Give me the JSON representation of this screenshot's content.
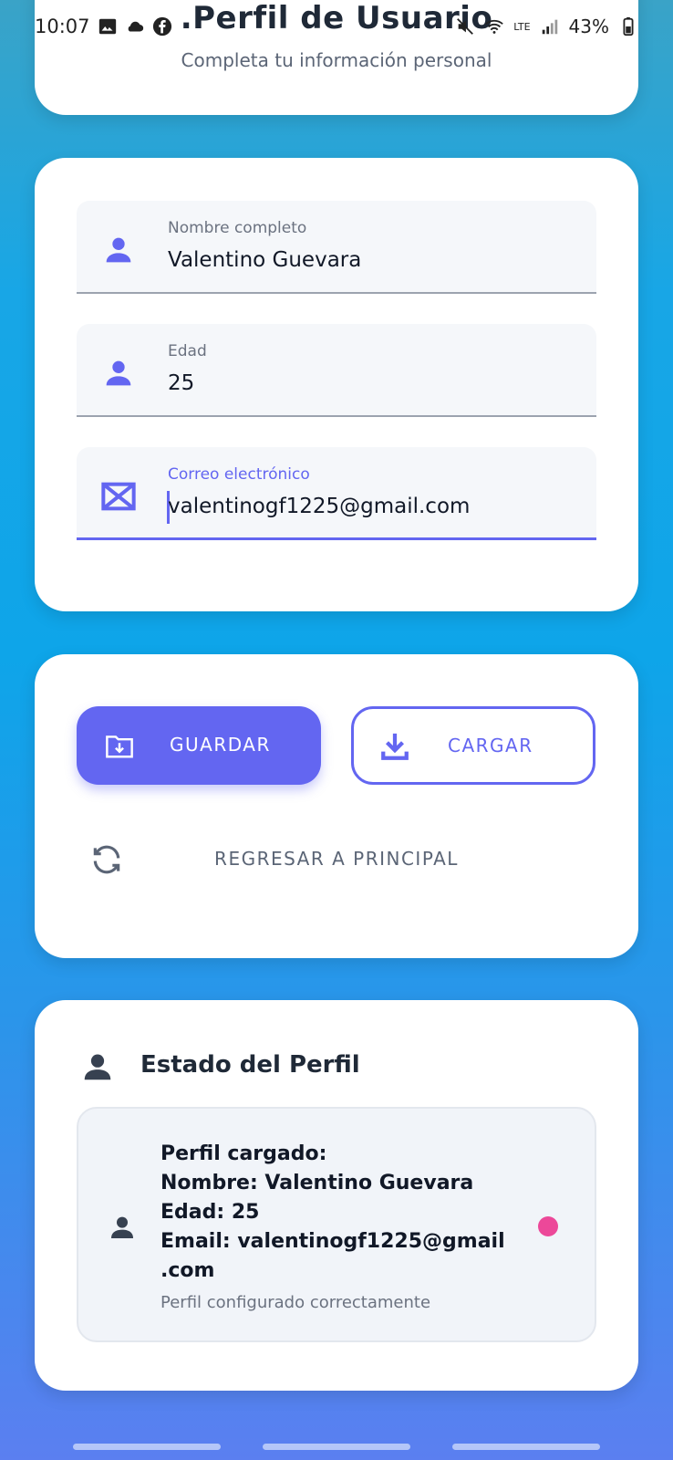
{
  "status_bar": {
    "time": "10:07",
    "battery": "43%",
    "network": "LTE"
  },
  "header": {
    "title": ".Perfil de Usuario",
    "subtitle": "Completa tu información personal"
  },
  "form": {
    "name_field": {
      "label": "Nombre completo",
      "value": "Valentino Guevara",
      "icon": "person-icon"
    },
    "age_field": {
      "label": "Edad",
      "value": "25",
      "icon": "person-icon"
    },
    "email_field": {
      "label": "Correo electrónico",
      "value": "valentinogf1225@gmail.com",
      "icon": "mail-icon",
      "focused": true
    }
  },
  "actions": {
    "save_label": "GUARDAR",
    "load_label": "CARGAR",
    "back_label": "REGRESAR A PRINCIPAL"
  },
  "profile_status": {
    "title": "Estado del Perfil",
    "lines": [
      "Perfil cargado:",
      "Nombre: Valentino Guevara",
      "Edad: 25",
      "Email: valentinogf1225@gmail",
      ".com"
    ],
    "note": "Perfil configurado correctamente",
    "indicator_color": "#ec4899"
  },
  "colors": {
    "accent": "#6366f1",
    "background_top": "#3aa3c7",
    "background_bottom": "#5b7ff0"
  }
}
